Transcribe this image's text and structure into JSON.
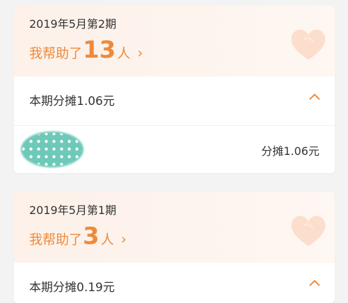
{
  "colors": {
    "accent": "#ee8a3c",
    "header_bg": "#fdf1e9",
    "page_bg": "#f3f3f3",
    "avatar": "#6ec9b8"
  },
  "cards": [
    {
      "period": "2019年5月第2期",
      "helped_prefix": "我帮助了",
      "helped_count": "13",
      "helped_suffix": "人",
      "chevron": "›",
      "share_label": "本期分摊1.06元",
      "detail_amount": "分摊1.06元",
      "icons": [
        "heart-icon",
        "chevron-right-icon",
        "chevron-up-icon",
        "avatar"
      ]
    },
    {
      "period": "2019年5月第1期",
      "helped_prefix": "我帮助了",
      "helped_count": "3",
      "helped_suffix": "人",
      "chevron": "›",
      "share_label": "本期分摊0.19元",
      "icons": [
        "heart-icon",
        "chevron-right-icon",
        "chevron-up-icon"
      ]
    }
  ]
}
